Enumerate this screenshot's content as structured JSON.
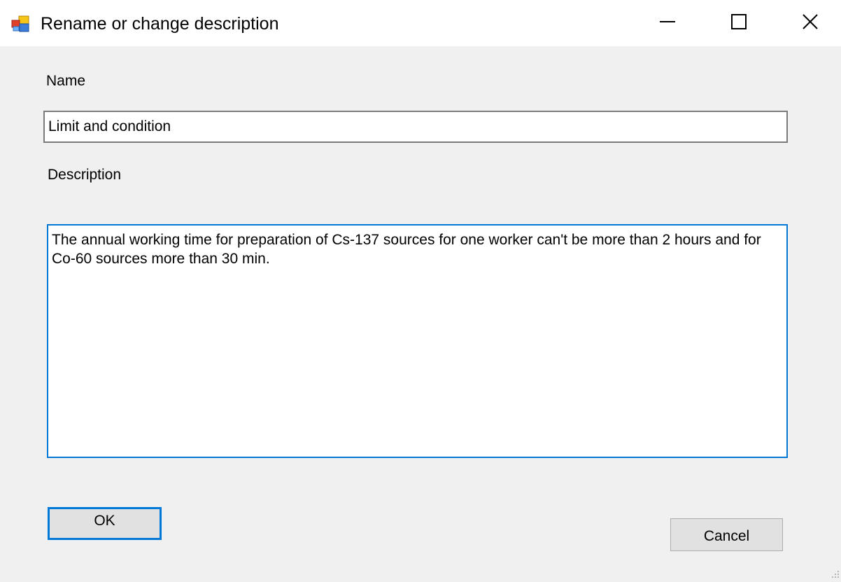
{
  "window": {
    "title": "Rename or change description",
    "icon": "app-window-icon",
    "controls": {
      "minimize": "minimize-icon",
      "maximize": "maximize-icon",
      "close": "close-icon"
    }
  },
  "form": {
    "name_label": "Name",
    "name_value": "Limit and condition",
    "description_label": "Description",
    "description_value": "The annual working time for preparation of Cs-137 sources for one worker can't be more than 2 hours and for Co-60 sources more than 30 min."
  },
  "buttons": {
    "ok_label": "OK",
    "cancel_label": "Cancel"
  },
  "colors": {
    "focus_accent": "#0078d7",
    "dialog_background": "#f0f0f0",
    "button_face": "#e1e1e1"
  }
}
